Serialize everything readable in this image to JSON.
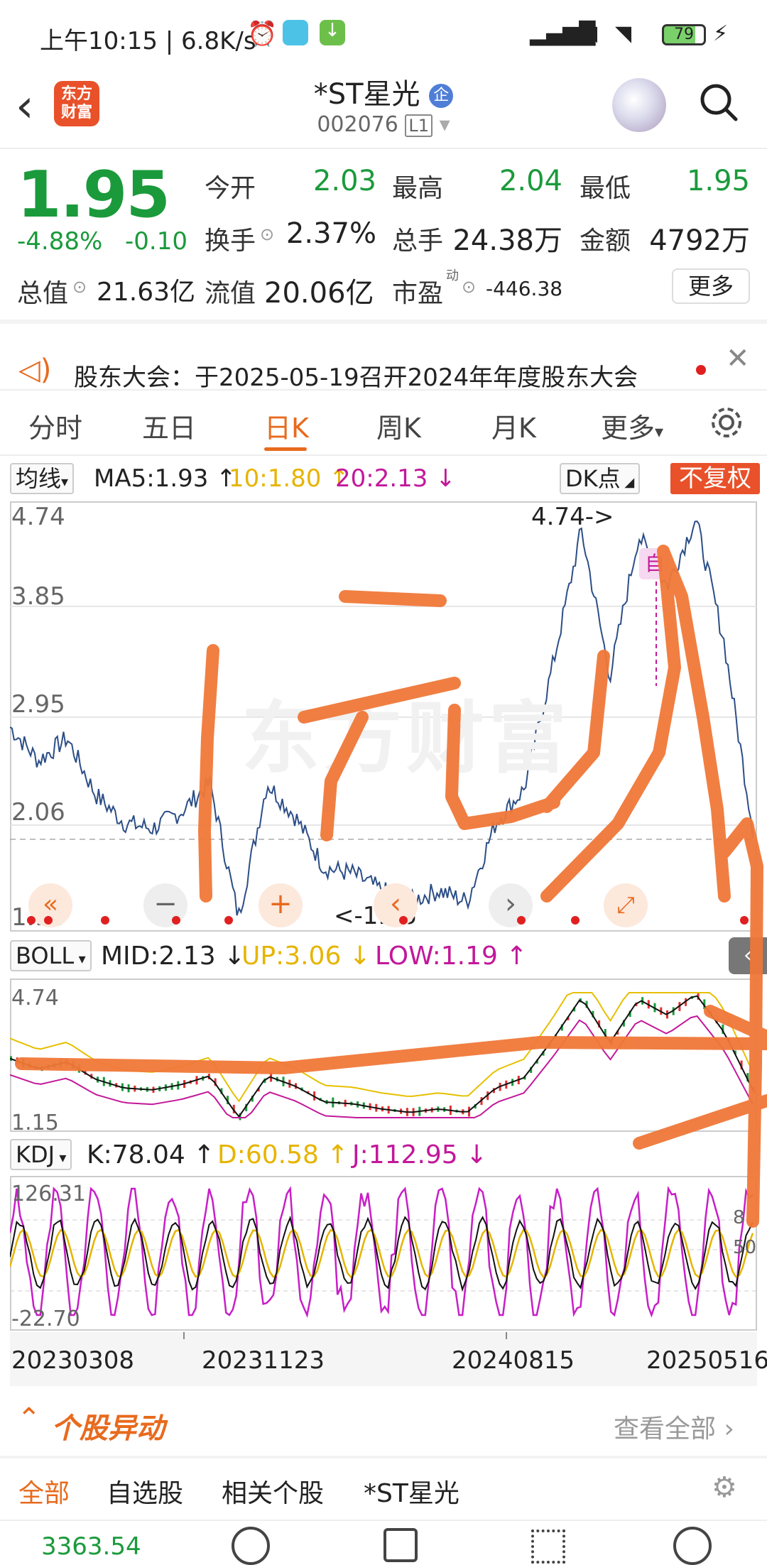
{
  "status_bar": {
    "time": "上午10:15 | 6.8K/s",
    "battery": "79"
  },
  "header": {
    "logo_text": "东方财富",
    "stock_name": "*ST星光",
    "badge": "企",
    "stock_code": "002076",
    "level": "L1"
  },
  "quote": {
    "price": "1.95",
    "change_pct": "-4.88%",
    "change": "-0.10",
    "fields": {
      "open_label": "今开",
      "open": "2.03",
      "high_label": "最高",
      "high": "2.04",
      "low_label": "最低",
      "low": "1.95",
      "turnover_label": "换手",
      "turnover": "2.37%",
      "volume_label": "总手",
      "volume": "24.38万",
      "amount_label": "金额",
      "amount": "4792万",
      "total_cap_label": "总值",
      "total_cap": "21.63亿",
      "float_cap_label": "流值",
      "float_cap": "20.06亿",
      "pe_label": "市盈",
      "pe_sup": "动",
      "pe": "-446.38"
    },
    "more_label": "更多"
  },
  "notice": {
    "text": "股东大会：于2025-05-19召开2024年年度股东大会"
  },
  "chart_tabs": [
    "分时",
    "五日",
    "日K",
    "周K",
    "月K",
    "更多"
  ],
  "active_tab": "日K",
  "ma_row": {
    "select": "均线",
    "ma5": "MA5:1.93 ↑",
    "ma10": "10:1.80 ↑",
    "ma20": "20:2.13 ↓",
    "dk": "DK点",
    "fq": "不复权"
  },
  "main_chart": {
    "y_ticks": [
      "4.74",
      "3.85",
      "2.95",
      "2.06",
      "1.16"
    ],
    "max_label": "4.74->",
    "min_label": "<-1.16",
    "watermark": "东方财富"
  },
  "boll_row": {
    "select": "BOLL",
    "mid": "MID:2.13 ↓",
    "up": "UP:3.06 ↓",
    "low": "LOW:1.19 ↑",
    "y_top": "4.74",
    "y_bottom": "1.15"
  },
  "kdj_row": {
    "select": "KDJ",
    "k": "K:78.04 ↑",
    "d": "D:60.58 ↑",
    "j": "J:112.95 ↓",
    "y_top": "126.31",
    "y_bottom": "-22.70",
    "right_a": "8",
    "right_b": "50"
  },
  "x_dates": [
    "20230308",
    "20231123",
    "20240815",
    "20250516"
  ],
  "section": {
    "title": "个股异动",
    "view_all": "查看全部"
  },
  "sub_tabs": [
    "全部",
    "自选股",
    "相关个股",
    "*ST星光"
  ],
  "bottom_bar": {
    "index_value": "3363.54"
  },
  "chart_data": {
    "type": "line",
    "title": "",
    "x_labels": [
      "20230308",
      "20231123",
      "20240815",
      "20250516"
    ],
    "ylim": [
      1.16,
      4.74
    ],
    "series": [
      {
        "values": [
          2.85,
          2.55,
          2.75,
          2.25,
          2.0,
          1.95,
          2.1,
          2.35,
          1.16,
          2.35,
          2.05,
          1.6,
          1.55,
          1.4,
          1.3,
          1.4,
          1.3,
          2.0,
          2.3,
          3.4,
          4.6,
          3.3,
          4.55,
          4.1,
          4.7,
          3.6,
          1.95
        ]
      }
    ],
    "colors": {
      "price": "#2c4e86",
      "accent": "#e86a1d",
      "up": "#e03030",
      "down": "#1a9a3b"
    }
  }
}
